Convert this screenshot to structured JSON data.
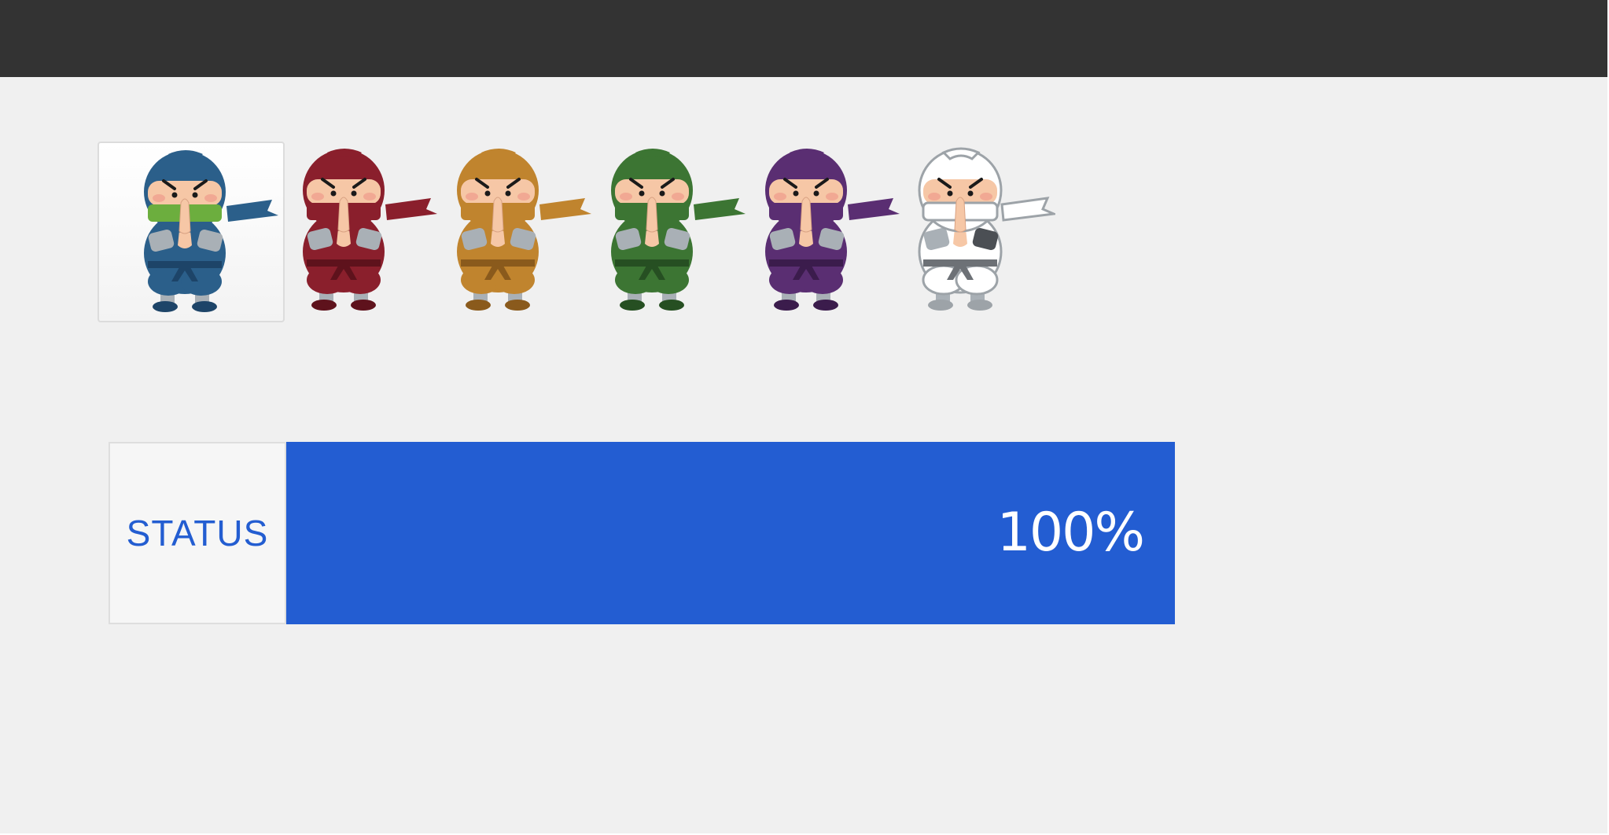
{
  "ninjas": [
    {
      "icon": "ninja-blue-icon",
      "body": "#2b5f8a",
      "dark": "#1d4468",
      "mask": "#6cae3e",
      "selected": true
    },
    {
      "icon": "ninja-red-icon",
      "body": "#8a1f2c",
      "dark": "#5e121c",
      "mask": "#8a1f2c",
      "selected": false
    },
    {
      "icon": "ninja-orange-icon",
      "body": "#c0842e",
      "dark": "#8a5a1c",
      "mask": "#c0842e",
      "selected": false
    },
    {
      "icon": "ninja-green-icon",
      "body": "#3c7533",
      "dark": "#264f22",
      "mask": "#3c7533",
      "selected": false
    },
    {
      "icon": "ninja-purple-icon",
      "body": "#5a2e72",
      "dark": "#3b1c4c",
      "mask": "#5a2e72",
      "selected": false
    },
    {
      "icon": "ninja-white-icon",
      "body": "#ffffff",
      "dark": "#9da3a8",
      "mask": "#ffffff",
      "selected": false
    }
  ],
  "status": {
    "label": "STATUS",
    "value_text": "100%",
    "progress": 1.0,
    "bar_color": "#235dd2"
  }
}
